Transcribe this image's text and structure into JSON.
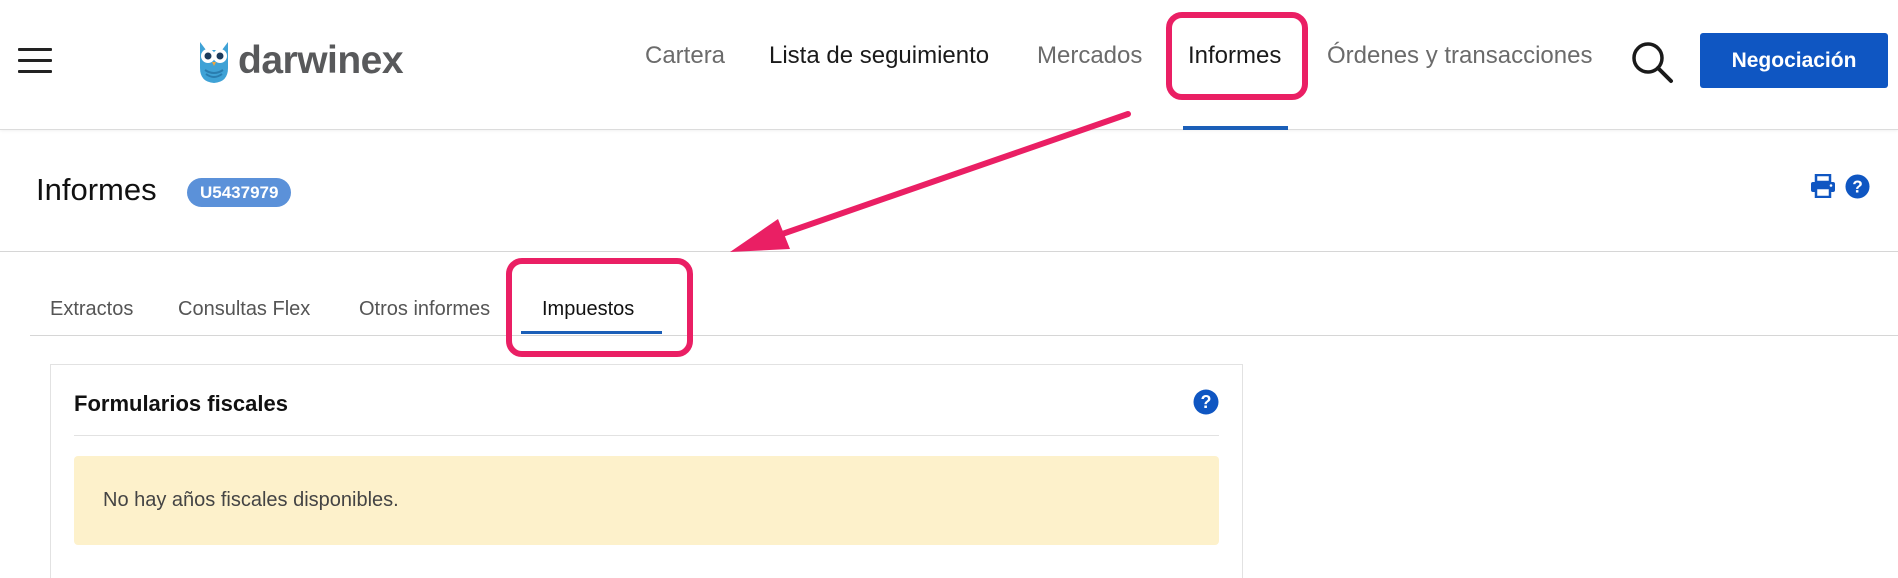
{
  "brand": {
    "name": "darwinex",
    "accent_color": "#0f56c2"
  },
  "nav": {
    "items": [
      {
        "label": "Cartera"
      },
      {
        "label": "Lista de seguimiento"
      },
      {
        "label": "Mercados"
      },
      {
        "label": "Informes",
        "active": true
      },
      {
        "label": "Órdenes y transacciones"
      }
    ],
    "search_icon": "search-icon",
    "trade_button": "Negociación"
  },
  "page": {
    "title": "Informes",
    "account_badge": "U5437979",
    "icons": [
      "print-icon",
      "help-icon"
    ]
  },
  "tabs": [
    {
      "label": "Extractos"
    },
    {
      "label": "Consultas Flex"
    },
    {
      "label": "Otros informes"
    },
    {
      "label": "Impuestos",
      "active": true
    }
  ],
  "card": {
    "title": "Formularios fiscales",
    "alert_text": "No hay años fiscales disponibles."
  },
  "annotation": {
    "highlight_color": "#ea1f64"
  }
}
